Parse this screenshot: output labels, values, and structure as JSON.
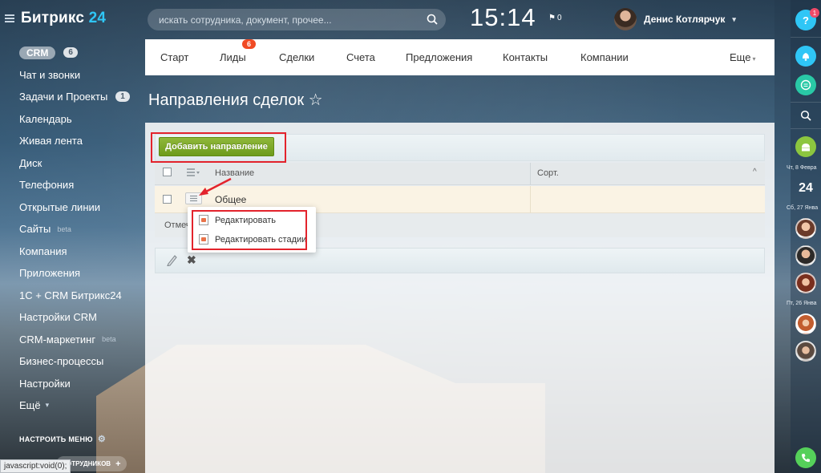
{
  "app": {
    "logo_text": "Битрикс",
    "logo_num": "24"
  },
  "header": {
    "search_placeholder": "искать сотрудника, документ, прочее...",
    "clock": "15:14",
    "flag_count": "0",
    "user_name": "Денис Котлярчук"
  },
  "sidebar": {
    "items": [
      {
        "label": "CRM",
        "counter": "6",
        "active": true
      },
      {
        "label": "Чат и звонки"
      },
      {
        "label": "Задачи и Проекты",
        "counter": "1"
      },
      {
        "label": "Календарь"
      },
      {
        "label": "Живая лента"
      },
      {
        "label": "Диск"
      },
      {
        "label": "Телефония"
      },
      {
        "label": "Открытые линии"
      },
      {
        "label": "Сайты",
        "sup": "beta"
      },
      {
        "label": "Компания"
      },
      {
        "label": "Приложения"
      },
      {
        "label": "1С + CRM Битрикс24"
      },
      {
        "label": "Настройки CRM"
      },
      {
        "label": "CRM-маркетинг",
        "sup": "beta"
      },
      {
        "label": "Бизнес-процессы"
      },
      {
        "label": "Настройки"
      },
      {
        "label": "Ещё"
      }
    ],
    "settings_label": "НАСТРОИТЬ МЕНЮ",
    "invite_label": "СОТРУДНИКОВ",
    "status_text": "javascript:void(0);"
  },
  "tabs": [
    {
      "label": "Старт"
    },
    {
      "label": "Лиды",
      "badge": "6"
    },
    {
      "label": "Сделки"
    },
    {
      "label": "Счета"
    },
    {
      "label": "Предложения"
    },
    {
      "label": "Контакты"
    },
    {
      "label": "Компании"
    },
    {
      "label": "Еще"
    }
  ],
  "page": {
    "title": "Направления сделок ☆",
    "add_button": "Добавить направление",
    "col_name": "Название",
    "col_sort": "Сорт.",
    "row_name": "Общее",
    "footer_text": "Отмеч",
    "popup_items": [
      "Редактировать",
      "Редактировать стадии"
    ]
  },
  "rail": {
    "help_badge": "1",
    "dates": [
      "Чт, 8 Февра",
      "Сб, 27 Янва",
      "Пт, 26 Янва"
    ],
    "b24_label": "24"
  },
  "colors": {
    "accent": "#2fc6f6",
    "add_button": "#7aab26",
    "highlight_box": "#e3232c",
    "badge": "#f04a24"
  }
}
